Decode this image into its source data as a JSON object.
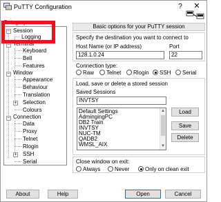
{
  "window": {
    "title": "PuTTY Configuration",
    "help_label": "?",
    "close_label": "✕"
  },
  "sidebar": {
    "category_label": "Category:",
    "items": [
      {
        "label": "Session"
      },
      {
        "label": "Logging"
      },
      {
        "label": "Terminal"
      },
      {
        "label": "Keyboard"
      },
      {
        "label": "Bell"
      },
      {
        "label": "Features"
      },
      {
        "label": "Window"
      },
      {
        "label": "Appearance"
      },
      {
        "label": "Behaviour"
      },
      {
        "label": "Translation"
      },
      {
        "label": "Selection"
      },
      {
        "label": "Colours"
      },
      {
        "label": "Connection"
      },
      {
        "label": "Data"
      },
      {
        "label": "Proxy"
      },
      {
        "label": "Telnet"
      },
      {
        "label": "Rlogin"
      },
      {
        "label": "SSH"
      },
      {
        "label": "Serial"
      }
    ],
    "highlight_color": "#e8131b"
  },
  "main": {
    "header": "Basic options for your PuTTY session",
    "destination_label": "Specify the destination you want to connect to",
    "host_label": "Host Name (or IP address)",
    "port_label": "Port",
    "host_value": "128.1.0.24",
    "port_value": "22",
    "conn_type_label": "Connection type:",
    "conn_types": [
      {
        "label": "Raw",
        "checked": false
      },
      {
        "label": "Telnet",
        "checked": false
      },
      {
        "label": "Rlogin",
        "checked": false
      },
      {
        "label": "SSH",
        "checked": true
      },
      {
        "label": "Serial",
        "checked": false
      }
    ],
    "sessions_group_label": "Load, save or delete a stored session",
    "saved_sessions_label": "Saved Sessions",
    "saved_session_value": "INVTSY",
    "sessions": [
      "Default Settings",
      "AdmingingPC",
      "DB2 Train",
      "INVTSY",
      "NUC-TM",
      "QADB2",
      "WMSL_AIX"
    ],
    "load_label": "Load",
    "save_label": "Save",
    "delete_label": "Delete",
    "close_exit_label": "Close window on exit:",
    "close_options": [
      {
        "label": "Always",
        "checked": false
      },
      {
        "label": "Never",
        "checked": false
      },
      {
        "label": "Only on clean exit",
        "checked": true
      }
    ]
  },
  "footer": {
    "about_label": "About",
    "help_label": "Help",
    "open_label": "Open",
    "cancel_label": "Cancel"
  }
}
